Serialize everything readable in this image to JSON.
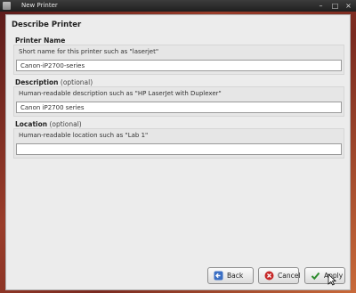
{
  "window": {
    "title": "New Printer"
  },
  "page": {
    "heading": "Describe Printer"
  },
  "sections": [
    {
      "label": "Printer Name",
      "optional": "",
      "hint": "Short name for this printer such as \"laserjet\"",
      "value": "Canon-iP2700-series"
    },
    {
      "label": "Description",
      "optional": "(optional)",
      "hint": "Human-readable description such as \"HP LaserJet with Duplexer\"",
      "value": "Canon iP2700 series"
    },
    {
      "label": "Location",
      "optional": "(optional)",
      "hint": "Human-readable location such as \"Lab 1\"",
      "value": ""
    }
  ],
  "buttons": {
    "back": "Back",
    "cancel": "Cancel",
    "apply": "Apply"
  },
  "icons": {
    "back": "arrow-left-icon",
    "cancel": "cancel-icon",
    "apply": "checkmark-icon"
  },
  "colors": {
    "back_icon": "#3b6fc4",
    "cancel_icon": "#c62828",
    "apply_icon": "#2e8b2e"
  }
}
